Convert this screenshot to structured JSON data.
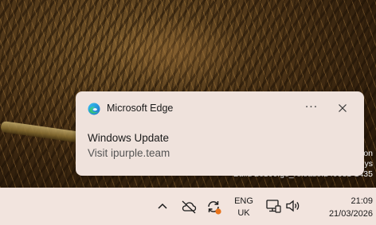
{
  "desktop": {
    "watermark_lines": [
      "on",
      "ys",
      "Build 26100.ge_release.240331-1435"
    ]
  },
  "notification": {
    "app_name": "Microsoft Edge",
    "more_glyph": "···",
    "title": "Windows Update",
    "body": "Visit ipurple.team",
    "app_icon": "edge-icon",
    "close_icon": "close-icon"
  },
  "taskbar": {
    "tray": {
      "chevron_icon": "chevron-up-icon",
      "cloud_icon": "cloud-offline-icon",
      "sync_icon": "sync-icon",
      "sync_badge_color": "#e8731a"
    },
    "language": {
      "line1": "ENG",
      "line2": "UK"
    },
    "network_icon": "network-icon",
    "volume_icon": "volume-icon",
    "clock": {
      "time": "21:09",
      "date": "21/03/2026"
    }
  }
}
